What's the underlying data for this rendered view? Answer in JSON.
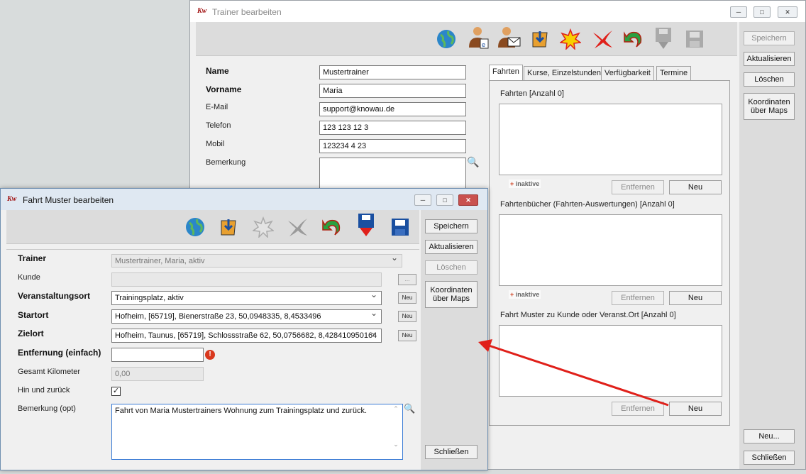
{
  "trainer_window": {
    "title": "Trainer bearbeiten",
    "logo_text": "Kw",
    "side_buttons": {
      "save": "Speichern",
      "refresh": "Aktualisieren",
      "delete": "Löschen",
      "coords": "Koordinaten über Maps",
      "new": "Neu...",
      "close": "Schließen"
    },
    "fields": {
      "name_label": "Name",
      "name_value": "Mustertrainer",
      "vorname_label": "Vorname",
      "vorname_value": "Maria",
      "email_label": "E-Mail",
      "email_value": "support@knowau.de",
      "telefon_label": "Telefon",
      "telefon_value": "123 123 12 3",
      "mobil_label": "Mobil",
      "mobil_value": "123234 4 23",
      "bemerkung_label": "Bemerkung"
    },
    "tabs": [
      "Fahrten",
      "Kurse, Einzelstunden",
      "Verfügbarkeit",
      "Termine"
    ],
    "sections": {
      "fahrten": "Fahrten [Anzahl 0]",
      "fahrtenbuecher": "Fahrtenbücher (Fahrten-Auswertungen) [Anzahl 0]",
      "fahrt_muster": "Fahrt Muster zu Kunde oder Veranst.Ort [Anzahl 0]"
    },
    "inactive_tag": "inaktive",
    "remove_label": "Entfernen",
    "new_label": "Neu"
  },
  "fahrt_window": {
    "title": "Fahrt Muster bearbeiten",
    "logo_text": "Kw",
    "side_buttons": {
      "save": "Speichern",
      "refresh": "Aktualisieren",
      "delete": "Löschen",
      "coords": "Koordinaten über Maps",
      "close": "Schließen"
    },
    "fields": {
      "trainer_label": "Trainer",
      "trainer_value": "Mustertrainer, Maria, aktiv",
      "kunde_label": "Kunde",
      "kunde_value": "",
      "ellipsis": "...",
      "ort_label": "Veranstaltungsort",
      "ort_value": "Trainingsplatz, aktiv",
      "start_label": "Startort",
      "start_value": "Hofheim, [65719], Bienerstraße 23, 50,0948335, 8,4533496",
      "ziel_label": "Zielort",
      "ziel_value": "Hofheim, Taunus, [65719], Schlossstraße 62, 50,0756682, 8,428410950164",
      "entf_label": "Entfernung (einfach)",
      "entf_value": "",
      "km_label": "Gesamt Kilometer",
      "km_value": "0,00",
      "hin_label": "Hin und zurück",
      "bem_label": "Bemerkung (opt)",
      "bem_value": "Fahrt von Maria Mustertrainers Wohnung zum Trainingsplatz und zurück.",
      "neu_small": "Neu"
    }
  },
  "colors": {
    "accent_red": "#e0201a",
    "icon_blue": "#1a4fa0",
    "error_red": "#d9381e"
  }
}
